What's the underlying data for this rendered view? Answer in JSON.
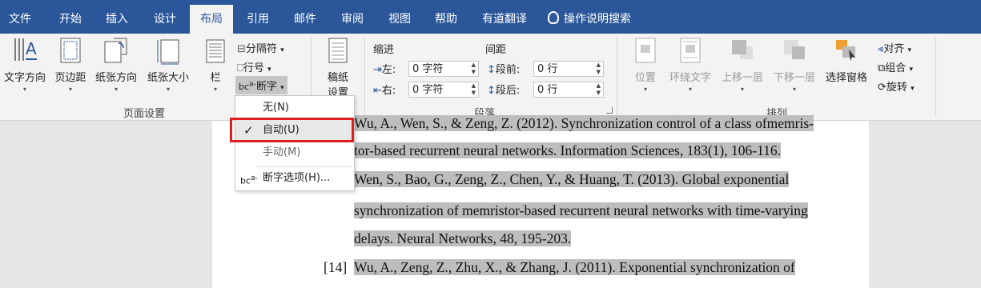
{
  "tabs": [
    "文件",
    "开始",
    "插入",
    "设计",
    "布局",
    "引用",
    "邮件",
    "审阅",
    "视图",
    "帮助",
    "有道翻译"
  ],
  "tellme": "操作说明搜索",
  "page_setup": {
    "text_direction": "文字方向",
    "margins": "页边距",
    "orientation": "纸张方向",
    "size": "纸张大小",
    "columns": "栏",
    "breaks": "分隔符",
    "line_numbers": "行号",
    "hyphenation": "断字",
    "group_label": "页面设置"
  },
  "manuscript": {
    "line1": "稿纸",
    "line2": "设置"
  },
  "paragraph": {
    "indent_title": "缩进",
    "spacing_title": "间距",
    "left_label": "左:",
    "right_label": "右:",
    "before_label": "段前:",
    "after_label": "段后:",
    "left_value": "0 字符",
    "right_value": "0 字符",
    "before_value": "0 行",
    "after_value": "0 行",
    "group_label": "段落"
  },
  "arrange": {
    "position": "位置",
    "wrap_text": "环绕文字",
    "bring_forward": "上移一层",
    "send_backward": "下移一层",
    "selection_pane": "选择窗格",
    "align": "对齐",
    "group": "组合",
    "rotate": "旋转",
    "group_label": "排列"
  },
  "menu": {
    "none": "无(N)",
    "auto": "自动(U)",
    "manual": "手动(M)",
    "options": "断字选项(H)..."
  },
  "document": {
    "line1": "Wu, A., Wen, S., & Zeng, Z. (2012). Synchronization control of a class ofmemris-",
    "line2": "tor-based recurrent neural networks. Information Sciences, 183(1), 106-116.",
    "line3": "Wen, S., Bao, G., Zeng, Z., Chen, Y., & Huang, T. (2013). Global exponential",
    "line4": "synchronization of memristor-based recurrent neural networks with time-varying",
    "line5": "delays. Neural Networks, 48, 195-203.",
    "ref_num": "[14]",
    "line6": "Wu, A., Zeng, Z., Zhu, X., & Zhang, J. (2011). Exponential synchronization of"
  },
  "colors": {
    "tabbar": "#2b579a",
    "highlight": "#bdbdbd",
    "annotation_box": "#e02020"
  }
}
